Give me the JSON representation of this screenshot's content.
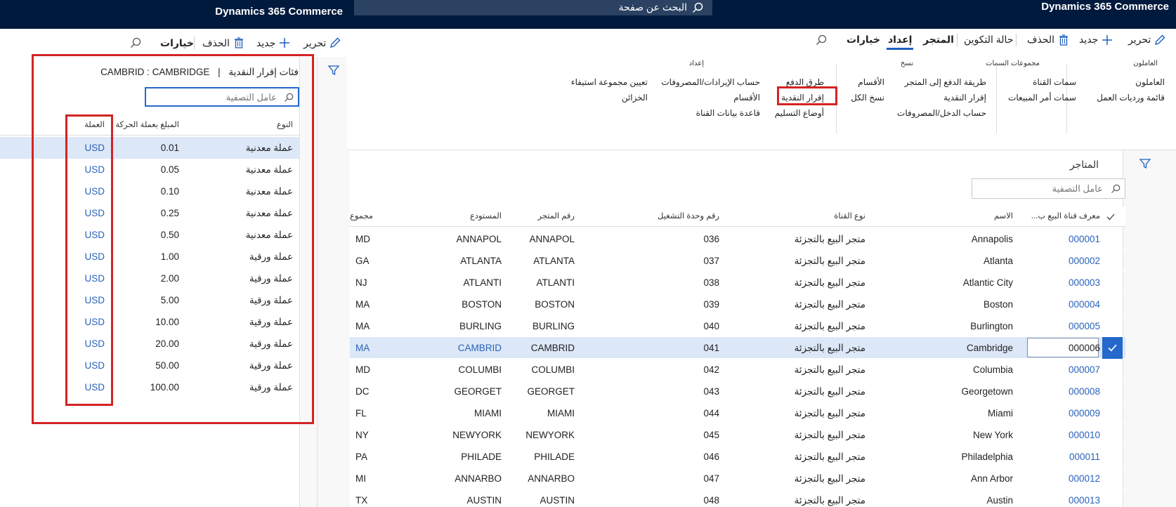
{
  "main": {
    "brand": "Dynamics 365 Commerce",
    "search_text": "البحث عن صفحة",
    "commands": {
      "edit": "تحرير",
      "new": "جديد",
      "delete": "الحذف",
      "config_state": "حالة التكوين",
      "tab_store": "المتجر",
      "tab_setup": "إعداد",
      "options": "خيارات"
    },
    "ribbon": {
      "workers": {
        "title": "العاملون",
        "items": [
          "العاملون",
          "قائمة ورديات العمل"
        ]
      },
      "attribute_groups": {
        "title": "مجموعات السمات",
        "items": [
          "سمات القناة",
          "سمات أمر المبيعات"
        ]
      },
      "copy": {
        "title": "نسخ",
        "items": [
          "طريقة الدفع إلى المتجر",
          "إقرار النقدية",
          "حساب الدخل/المصروفات",
          "الأقسام",
          "نسخ الكل"
        ]
      },
      "setup": {
        "title": "إعداد",
        "items": [
          "طرق الدفع",
          "إقرار النقدية",
          "أوضاع التسليم",
          "حساب الإيرادات/المصروفات",
          "الأقسام",
          "قاعدة بيانات القناة",
          "تعيين مجموعة استيفاء",
          "الخزائن"
        ]
      }
    },
    "stores": {
      "title": "المتاجر",
      "filter_placeholder": "عامل التصفية",
      "columns": [
        "معرف قناة البيع ب...",
        "الاسم",
        "نوع القناة",
        "رقم وحدة التشغيل",
        "رقم المتجر",
        "المستودع",
        "مجموع"
      ],
      "rows": [
        {
          "id": "000001",
          "name": "Annapolis",
          "type": "متجر البيع بالتجزئة",
          "op_unit": "036",
          "store_no": "ANNAPOL",
          "warehouse": "ANNAPOL",
          "group": "MD"
        },
        {
          "id": "000002",
          "name": "Atlanta",
          "type": "متجر البيع بالتجزئة",
          "op_unit": "037",
          "store_no": "ATLANTA",
          "warehouse": "ATLANTA",
          "group": "GA"
        },
        {
          "id": "000003",
          "name": "Atlantic City",
          "type": "متجر البيع بالتجزئة",
          "op_unit": "038",
          "store_no": "ATLANTI",
          "warehouse": "ATLANTI",
          "group": "NJ"
        },
        {
          "id": "000004",
          "name": "Boston",
          "type": "متجر البيع بالتجزئة",
          "op_unit": "039",
          "store_no": "BOSTON",
          "warehouse": "BOSTON",
          "group": "MA"
        },
        {
          "id": "000005",
          "name": "Burlington",
          "type": "متجر البيع بالتجزئة",
          "op_unit": "040",
          "store_no": "BURLING",
          "warehouse": "BURLING",
          "group": "MA"
        },
        {
          "id": "000006",
          "name": "Cambridge",
          "type": "متجر البيع بالتجزئة",
          "op_unit": "041",
          "store_no": "CAMBRID",
          "warehouse": "CAMBRID",
          "group": "MA"
        },
        {
          "id": "000007",
          "name": "Columbia",
          "type": "متجر البيع بالتجزئة",
          "op_unit": "042",
          "store_no": "COLUMBI",
          "warehouse": "COLUMBI",
          "group": "MD"
        },
        {
          "id": "000008",
          "name": "Georgetown",
          "type": "متجر البيع بالتجزئة",
          "op_unit": "043",
          "store_no": "GEORGET",
          "warehouse": "GEORGET",
          "group": "DC"
        },
        {
          "id": "000009",
          "name": "Miami",
          "type": "متجر البيع بالتجزئة",
          "op_unit": "044",
          "store_no": "MIAMI",
          "warehouse": "MIAMI",
          "group": "FL"
        },
        {
          "id": "000010",
          "name": "New York",
          "type": "متجر البيع بالتجزئة",
          "op_unit": "045",
          "store_no": "NEWYORK",
          "warehouse": "NEWYORK",
          "group": "NY"
        },
        {
          "id": "000011",
          "name": "Philadelphia",
          "type": "متجر البيع بالتجزئة",
          "op_unit": "046",
          "store_no": "PHILADE",
          "warehouse": "PHILADE",
          "group": "PA"
        },
        {
          "id": "000012",
          "name": "Ann Arbor",
          "type": "متجر البيع بالتجزئة",
          "op_unit": "047",
          "store_no": "ANNARBO",
          "warehouse": "ANNARBO",
          "group": "MI"
        },
        {
          "id": "000013",
          "name": "Austin",
          "type": "متجر البيع بالتجزئة",
          "op_unit": "048",
          "store_no": "AUSTIN",
          "warehouse": "AUSTIN",
          "group": "TX"
        }
      ],
      "selected_index": 5
    }
  },
  "overlay": {
    "brand": "Dynamics 365 Commerce",
    "commands": {
      "edit": "تحرير",
      "new": "جديد",
      "delete": "الحذف",
      "options": "خيارات"
    },
    "title": "فئات إقرار النقدية",
    "title_sep": "|",
    "title_store": "CAMBRID : CAMBRIDGE",
    "filter_placeholder": "عامل التصفية",
    "columns": [
      "النوع",
      "المبلغ بعملة الحركة",
      "العملة"
    ],
    "rows": [
      {
        "type": "عملة معدنية",
        "amount": "0.01",
        "currency": "USD"
      },
      {
        "type": "عملة معدنية",
        "amount": "0.05",
        "currency": "USD"
      },
      {
        "type": "عملة معدنية",
        "amount": "0.10",
        "currency": "USD"
      },
      {
        "type": "عملة معدنية",
        "amount": "0.25",
        "currency": "USD"
      },
      {
        "type": "عملة معدنية",
        "amount": "0.50",
        "currency": "USD"
      },
      {
        "type": "عملة ورقية",
        "amount": "1.00",
        "currency": "USD"
      },
      {
        "type": "عملة ورقية",
        "amount": "2.00",
        "currency": "USD"
      },
      {
        "type": "عملة ورقية",
        "amount": "5.00",
        "currency": "USD"
      },
      {
        "type": "عملة ورقية",
        "amount": "10.00",
        "currency": "USD"
      },
      {
        "type": "عملة ورقية",
        "amount": "20.00",
        "currency": "USD"
      },
      {
        "type": "عملة ورقية",
        "amount": "50.00",
        "currency": "USD"
      },
      {
        "type": "عملة ورقية",
        "amount": "100.00",
        "currency": "USD"
      }
    ],
    "selected_index": 0
  },
  "colors": {
    "nav_bg": "#001a3d",
    "accent": "#1f5fbf",
    "link": "#2962b8",
    "selected_row": "#dce7f8",
    "highlight_box": "#d32424"
  }
}
